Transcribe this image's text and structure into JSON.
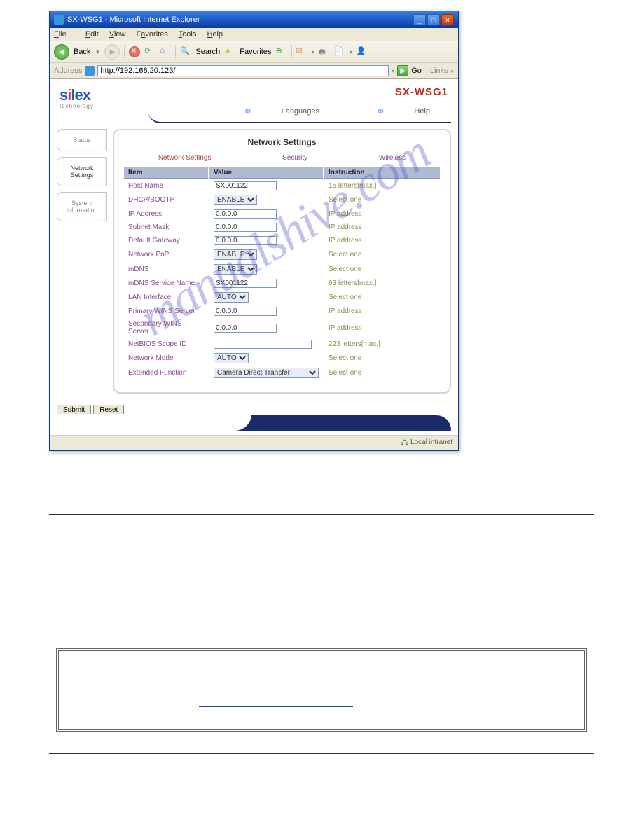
{
  "window": {
    "title": "SX-WSG1 - Microsoft Internet Explorer"
  },
  "menubar": {
    "file": "File",
    "edit": "Edit",
    "view": "View",
    "favorites": "Favorites",
    "tools": "Tools",
    "help": "Help"
  },
  "toolbar": {
    "back": "Back",
    "search": "Search",
    "favorites": "Favorites"
  },
  "addressbar": {
    "label": "Address",
    "url": "http://192.168.20.123/",
    "go": "Go",
    "links": "Links"
  },
  "page": {
    "brand": "silex",
    "brand_sub": "technology",
    "product": "SX-WSG1",
    "top_links": {
      "languages": "Languages",
      "help": "Help"
    }
  },
  "sidebar": {
    "tabs": [
      {
        "label": "Status"
      },
      {
        "label": "Network Settings"
      },
      {
        "label": "System Information"
      }
    ]
  },
  "panel": {
    "title": "Network Settings",
    "subtabs": {
      "net": "Network Settings",
      "sec": "Security",
      "wireless": "Wireless"
    },
    "headers": {
      "item": "Item",
      "value": "Value",
      "instruction": "Instruction"
    },
    "rows": [
      {
        "label": "Host Name",
        "type": "text",
        "value": "SX001122",
        "instr": "15 letters[max.]"
      },
      {
        "label": "DHCP/BOOTP",
        "type": "select",
        "value": "ENABLE",
        "instr": "Select one"
      },
      {
        "label": "IP Address",
        "type": "text",
        "value": "0.0.0.0",
        "instr": "IP address"
      },
      {
        "label": "Subnet Mask",
        "type": "text",
        "value": "0.0.0.0",
        "instr": "IP address"
      },
      {
        "label": "Default Gateway",
        "type": "text",
        "value": "0.0.0.0",
        "instr": "IP address"
      },
      {
        "label": "Network PnP",
        "type": "select",
        "value": "ENABLE",
        "instr": "Select one"
      },
      {
        "label": "mDNS",
        "type": "select",
        "value": "ENABLE",
        "instr": "Select one"
      },
      {
        "label": "mDNS Service Name",
        "type": "text",
        "value": "SX001122",
        "instr": "63 letters[max.]"
      },
      {
        "label": "LAN Interface",
        "type": "select",
        "value": "AUTO",
        "instr": "Select one"
      },
      {
        "label": "Primary WINS Server",
        "type": "text",
        "value": "0.0.0.0",
        "instr": "IP address"
      },
      {
        "label": "Secondary WINS Server",
        "type": "text",
        "value": "0.0.0.0",
        "instr": "IP address"
      },
      {
        "label": "NetBIOS Scope ID",
        "type": "textwide",
        "value": "",
        "instr": "223 letters[max.]"
      },
      {
        "label": "Network Mode",
        "type": "select",
        "value": "AUTO",
        "instr": "Select one"
      },
      {
        "label": "Extended Function",
        "type": "selectwide",
        "value": "Camera Direct Transfer",
        "instr": "Select one"
      }
    ]
  },
  "buttons": {
    "submit": "Submit",
    "reset": "Reset"
  },
  "statusbar": {
    "zone": "Local intranet"
  },
  "watermark": "manualshive.com"
}
